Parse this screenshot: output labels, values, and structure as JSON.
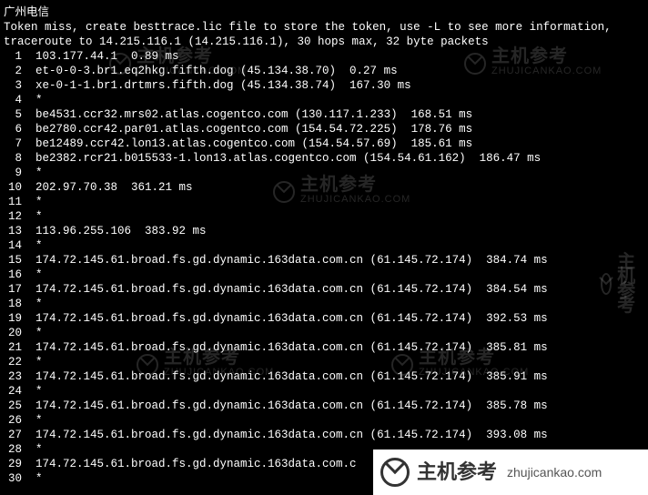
{
  "title": "广州电信",
  "info_line_1": "Token miss, create besttrace.lic file to store the token, use -L to see more information,",
  "info_line_2": "traceroute to 14.215.116.1 (14.215.116.1), 30 hops max, 32 byte packets",
  "hops": [
    {
      "n": "1",
      "text": "103.177.44.1  0.89 ms"
    },
    {
      "n": "2",
      "text": "et-0-0-3.br1.eq2hkg.fifth.dog (45.134.38.70)  0.27 ms"
    },
    {
      "n": "3",
      "text": "xe-0-1-1.br1.drtmrs.fifth.dog (45.134.38.74)  167.30 ms"
    },
    {
      "n": "4",
      "text": "*"
    },
    {
      "n": "5",
      "text": "be4531.ccr32.mrs02.atlas.cogentco.com (130.117.1.233)  168.51 ms"
    },
    {
      "n": "6",
      "text": "be2780.ccr42.par01.atlas.cogentco.com (154.54.72.225)  178.76 ms"
    },
    {
      "n": "7",
      "text": "be12489.ccr42.lon13.atlas.cogentco.com (154.54.57.69)  185.61 ms"
    },
    {
      "n": "8",
      "text": "be2382.rcr21.b015533-1.lon13.atlas.cogentco.com (154.54.61.162)  186.47 ms"
    },
    {
      "n": "9",
      "text": "*"
    },
    {
      "n": "10",
      "text": "202.97.70.38  361.21 ms"
    },
    {
      "n": "11",
      "text": "*"
    },
    {
      "n": "12",
      "text": "*"
    },
    {
      "n": "13",
      "text": "113.96.255.106  383.92 ms"
    },
    {
      "n": "14",
      "text": "*"
    },
    {
      "n": "15",
      "text": "174.72.145.61.broad.fs.gd.dynamic.163data.com.cn (61.145.72.174)  384.74 ms"
    },
    {
      "n": "16",
      "text": "*"
    },
    {
      "n": "17",
      "text": "174.72.145.61.broad.fs.gd.dynamic.163data.com.cn (61.145.72.174)  384.54 ms"
    },
    {
      "n": "18",
      "text": "*"
    },
    {
      "n": "19",
      "text": "174.72.145.61.broad.fs.gd.dynamic.163data.com.cn (61.145.72.174)  392.53 ms"
    },
    {
      "n": "20",
      "text": "*"
    },
    {
      "n": "21",
      "text": "174.72.145.61.broad.fs.gd.dynamic.163data.com.cn (61.145.72.174)  385.81 ms"
    },
    {
      "n": "22",
      "text": "*"
    },
    {
      "n": "23",
      "text": "174.72.145.61.broad.fs.gd.dynamic.163data.com.cn (61.145.72.174)  385.91 ms"
    },
    {
      "n": "24",
      "text": "*"
    },
    {
      "n": "25",
      "text": "174.72.145.61.broad.fs.gd.dynamic.163data.com.cn (61.145.72.174)  385.78 ms"
    },
    {
      "n": "26",
      "text": "*"
    },
    {
      "n": "27",
      "text": "174.72.145.61.broad.fs.gd.dynamic.163data.com.cn (61.145.72.174)  393.08 ms"
    },
    {
      "n": "28",
      "text": "*"
    },
    {
      "n": "29",
      "text": "174.72.145.61.broad.fs.gd.dynamic.163data.com.c"
    },
    {
      "n": "30",
      "text": "*"
    }
  ],
  "watermark": {
    "cn": "主机参考",
    "en": "ZHUJICANKAO.COM",
    "banner_en": "zhujicankao.com"
  }
}
